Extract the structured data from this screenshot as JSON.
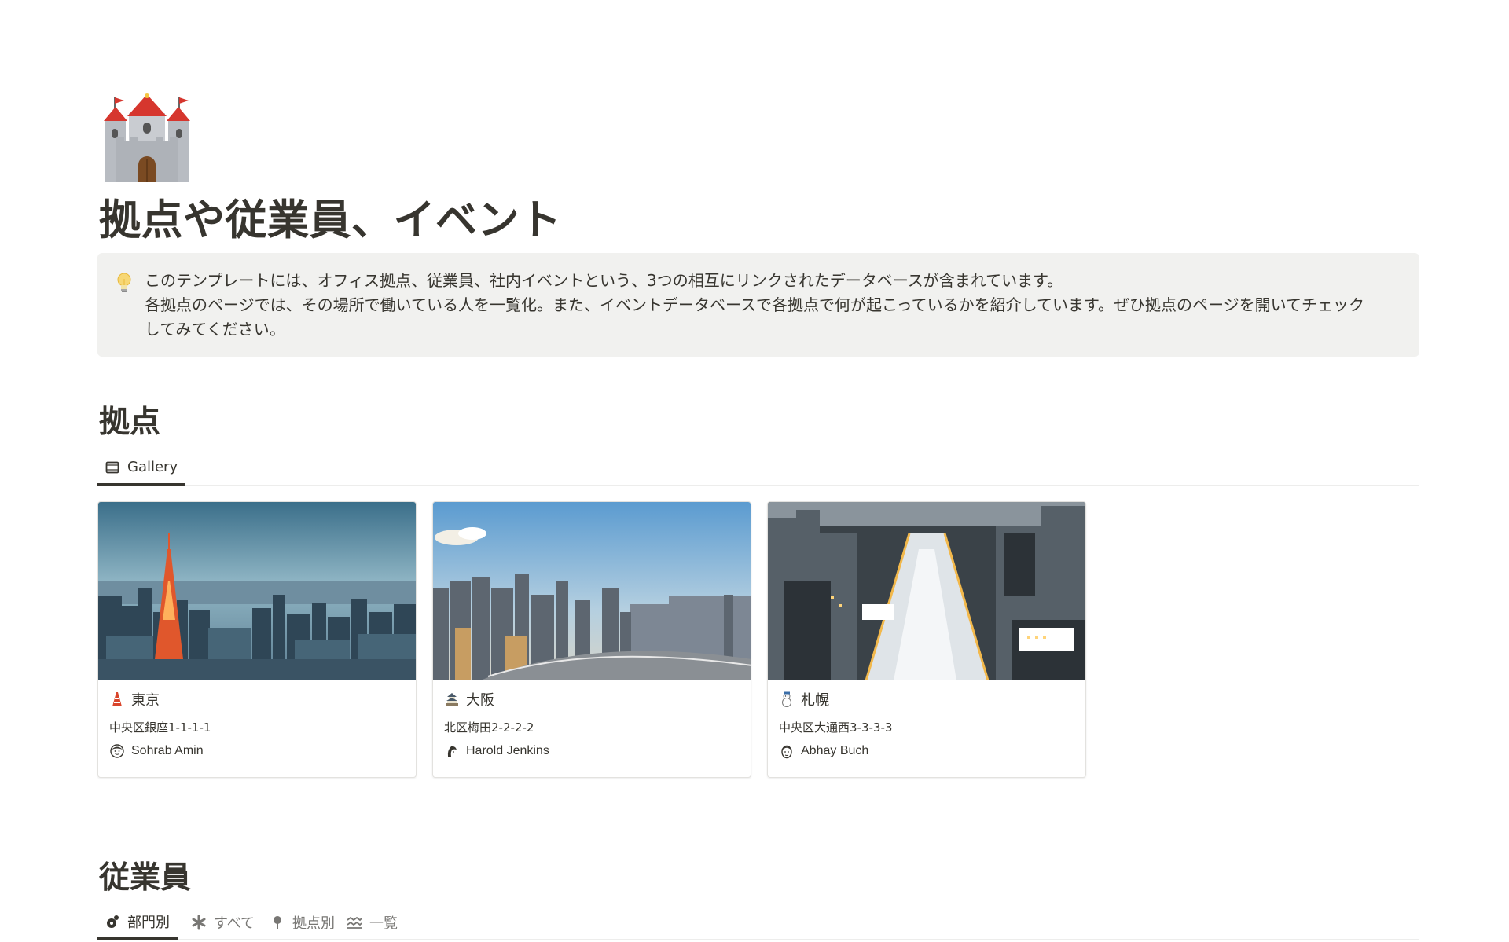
{
  "page": {
    "icon": "castle-icon",
    "title": "拠点や従業員、イベント"
  },
  "callout": {
    "icon": "lightbulb-icon",
    "line1": "このテンプレートには、オフィス拠点、従業員、社内イベントという、3つの相互にリンクされたデータベースが含まれています。",
    "line2": "各拠点のページでは、その場所で働いている人を一覧化。また、イベントデータベースで各拠点で何が起こっているかを紹介しています。ぜひ拠点のページを開いてチェック",
    "line3": "してみてください。"
  },
  "locations": {
    "heading": "拠点",
    "tabs": [
      {
        "label": "Gallery",
        "icon": "gallery-icon",
        "active": true
      }
    ],
    "cards": [
      {
        "name": "東京",
        "icon": "tokyo-tower-icon",
        "address": "中央区銀座1-1-1-1",
        "person": "Sohrab Amin",
        "cover": "tokyo-skyline-image"
      },
      {
        "name": "大阪",
        "icon": "osaka-castle-icon",
        "address": "北区梅田2-2-2-2",
        "person": "Harold Jenkins",
        "cover": "osaka-skyline-image"
      },
      {
        "name": "札幌",
        "icon": "snowman-icon",
        "address": "中央区大通西3-3-3-3",
        "person": "Abhay Buch",
        "cover": "sapporo-snow-festival-image"
      }
    ]
  },
  "employees": {
    "heading": "従業員",
    "tabs": [
      {
        "label": "部門別",
        "icon": "department-icon",
        "active": true
      },
      {
        "label": "すべて",
        "icon": "asterisk-icon",
        "active": false
      },
      {
        "label": "拠点別",
        "icon": "pin-icon",
        "active": false
      },
      {
        "label": "一覧",
        "icon": "list-waves-icon",
        "active": false
      }
    ]
  },
  "colors": {
    "text": "#37352f",
    "muted": "#787774",
    "callout_bg": "#f1f1ef",
    "border": "#e3e2df"
  }
}
